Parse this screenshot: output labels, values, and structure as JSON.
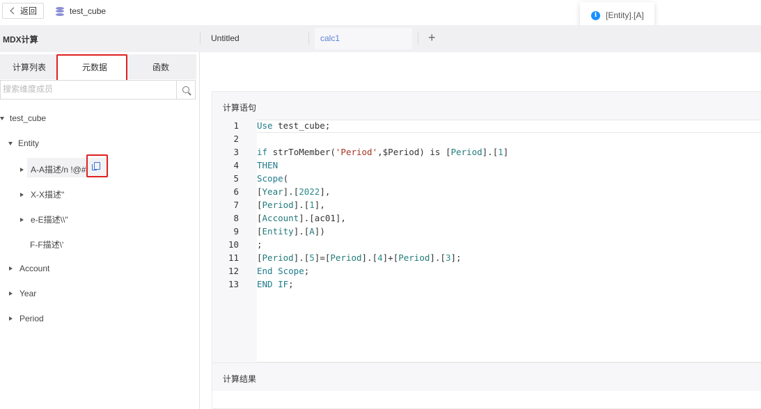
{
  "topbar": {
    "back_label": "返回",
    "cube_name": "test_cube"
  },
  "toast": {
    "message": "[Entity].[A]"
  },
  "header": {
    "title": "MDX计算",
    "tabs": [
      {
        "label": "Untitled"
      },
      {
        "label": "calc1"
      }
    ],
    "add_tab": "+"
  },
  "left": {
    "tabs": [
      {
        "label": "计算列表"
      },
      {
        "label": "元数据"
      },
      {
        "label": "函数"
      }
    ],
    "search_placeholder": "搜索维度成员",
    "tree": {
      "root": "test_cube",
      "entity": "Entity",
      "members": [
        "A-A描述/n !@#",
        "X-X描述\"",
        "e-E描述\\\\\"",
        "F-F描述\\'"
      ],
      "dims": [
        "Account",
        "Year",
        "Period"
      ]
    }
  },
  "stmt": {
    "title": "计算语句",
    "line_numbers": [
      "1",
      "2",
      "3",
      "4",
      "5",
      "6",
      "7",
      "8",
      "9",
      "10",
      "11",
      "12",
      "13"
    ]
  },
  "result": {
    "title": "计算结果"
  },
  "colors": {
    "accent": "#1890ff",
    "highlight": "#e02020",
    "link": "#5b7fd6"
  }
}
